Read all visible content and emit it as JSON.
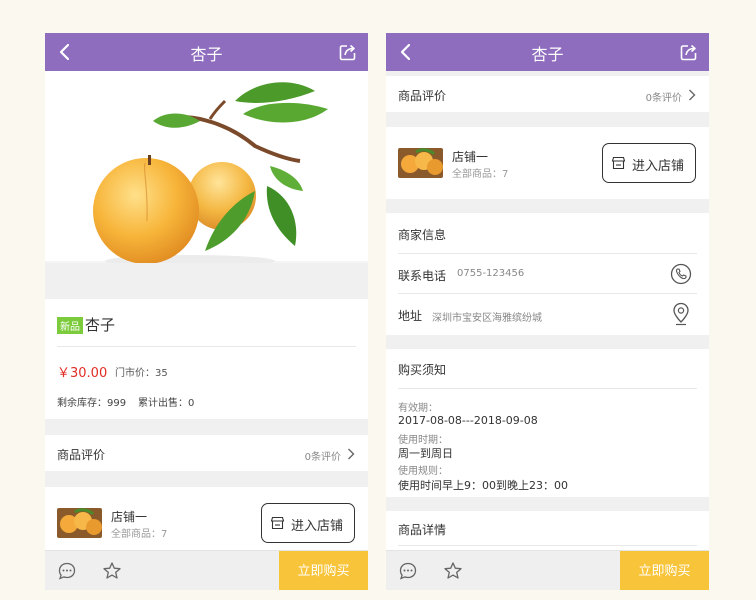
{
  "header": {
    "title": "杏子"
  },
  "product": {
    "new_badge": "新品",
    "name": "杏子",
    "price": "￥30.00",
    "store_price": "门市价：35",
    "stock": "剩余库存：999",
    "sold": "累计出售：0"
  },
  "review": {
    "label": "商品评价",
    "count": "0条评价"
  },
  "shop": {
    "name": "店铺一",
    "total": "全部商品：7",
    "enter_label": "进入店铺"
  },
  "merchant": {
    "title": "商家信息",
    "phone_label": "联系电话",
    "phone": "0755-123456",
    "address_label": "地址",
    "address": "深圳市宝安区海雅缤纷城"
  },
  "notice": {
    "title": "购买须知",
    "validity_label": "有效期：",
    "validity": "2017-08-08---2018-09-08",
    "usage_time_label": "使用时期：",
    "usage_time": "周一到周日",
    "rules_label": "使用规则：",
    "rules": "使用时间早上9：00到晚上23：00"
  },
  "details": {
    "title": "商品详情"
  },
  "footer": {
    "buy_label": "立即购买"
  },
  "colors": {
    "header": "#8e6cbe",
    "buy": "#f8c43a",
    "price": "#e02e24",
    "badge": "#7ccb3c"
  },
  "icons": [
    "back-icon",
    "share-icon",
    "chat-icon",
    "star-icon",
    "chevron-right-icon",
    "store-icon",
    "phone-icon",
    "location-icon"
  ]
}
